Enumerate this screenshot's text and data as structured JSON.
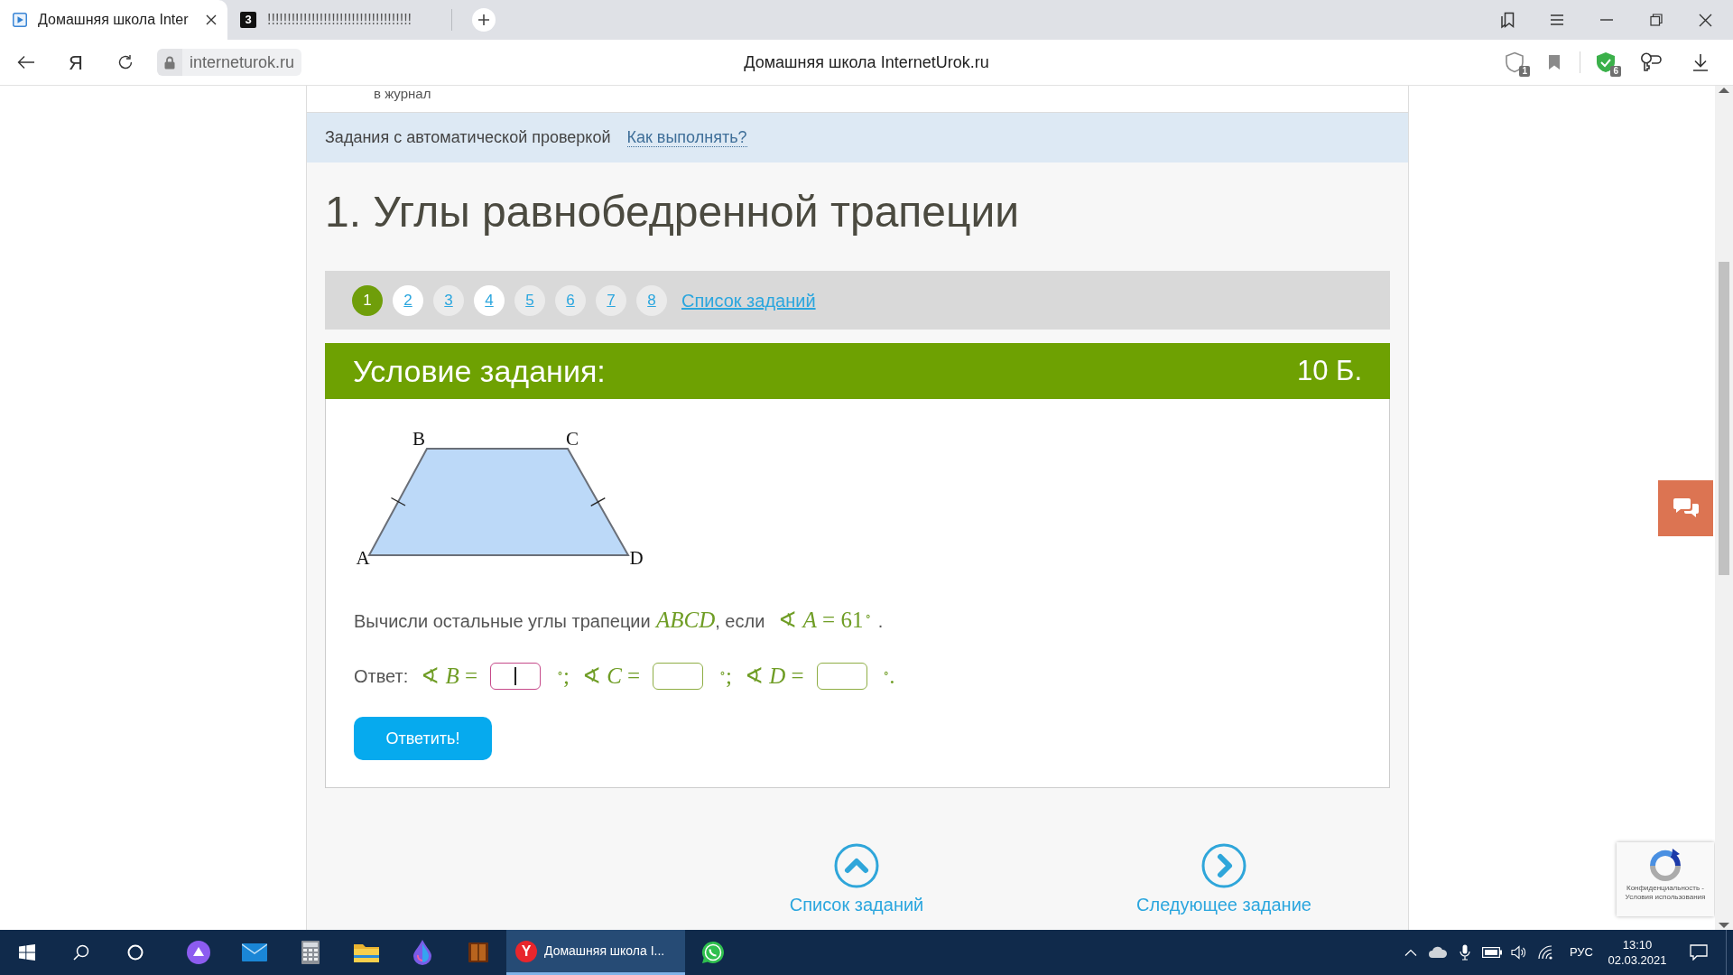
{
  "browser": {
    "tabs": [
      {
        "title": "Домашняя школа Inter",
        "selected": true
      },
      {
        "title": "!!!!!!!!!!!!!!!!!!!!!!!!!!!!!!!!!!!!",
        "selected": false,
        "favicon_text": "3"
      }
    ],
    "yandex_button": "Я",
    "url": "interneturok.ru",
    "page_title": "Домашняя школа InternetUrok.ru",
    "protect_badge": "1",
    "extensions_badge": "6"
  },
  "page": {
    "journal_link": "в журнал",
    "info_bar": {
      "text": "Задания с автоматической проверкой",
      "link": "Как выполнять?"
    },
    "title": "1. Углы равнобедренной трапеции",
    "pagination": {
      "pages": [
        {
          "label": "1",
          "selected": true,
          "visited": false
        },
        {
          "label": "2",
          "selected": false,
          "visited": true
        },
        {
          "label": "3",
          "selected": false,
          "visited": false
        },
        {
          "label": "4",
          "selected": false,
          "visited": true
        },
        {
          "label": "5",
          "selected": false,
          "visited": false
        },
        {
          "label": "6",
          "selected": false,
          "visited": false
        },
        {
          "label": "7",
          "selected": false,
          "visited": false
        },
        {
          "label": "8",
          "selected": false,
          "visited": false
        }
      ],
      "list_link": "Список заданий"
    },
    "task": {
      "header": "Условие задания:",
      "points": "10 Б.",
      "figure": {
        "vertices": [
          "A",
          "B",
          "C",
          "D"
        ]
      },
      "statement": [
        {
          "kind": "text",
          "text": "Вычисли остальные углы трапеции"
        },
        {
          "kind": "variable",
          "text": "ABCD"
        },
        {
          "kind": "text",
          "text": ", если"
        },
        {
          "kind": "math",
          "text": "∢ *A* = 61$^{∘}$"
        },
        {
          "kind": "text",
          "text": "."
        }
      ],
      "answer": {
        "label": "Ответ:",
        "fields": [
          {
            "prefix": "∢ *B* =",
            "suffix": "$^{∘}$;",
            "focused": true
          },
          {
            "prefix": "∢ *C* =",
            "suffix": "$^{∘}$;",
            "focused": false
          },
          {
            "prefix": "∢ *D* =",
            "suffix": "$^{∘}$.",
            "focused": false
          }
        ]
      },
      "submit": "Ответить!"
    },
    "bottom_nav": [
      {
        "kind": "up",
        "label": "Список заданий"
      },
      {
        "kind": "next",
        "label": "Следующее задание"
      }
    ],
    "recaptcha": {
      "lines": [
        "Конфиденциальность -",
        "Условия использования"
      ]
    }
  },
  "taskbar": {
    "apps": [
      {
        "kind": "assistant",
        "selected": false
      },
      {
        "kind": "mail",
        "selected": false
      },
      {
        "kind": "calculator",
        "selected": false
      },
      {
        "kind": "explorer",
        "selected": false
      },
      {
        "kind": "drop",
        "selected": false
      },
      {
        "kind": "book",
        "selected": false
      },
      {
        "kind": "browser",
        "selected": true,
        "logo": "Y",
        "title": "Домашняя школа I..."
      },
      {
        "kind": "whatsapp",
        "selected": false
      }
    ],
    "tray": {
      "language": "РУС",
      "time": "13:10",
      "date": "02.03.2021"
    }
  }
}
